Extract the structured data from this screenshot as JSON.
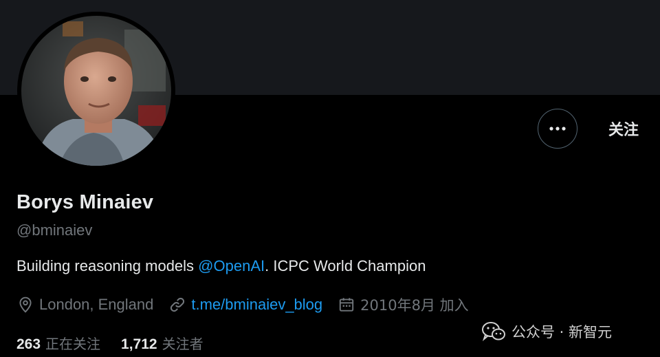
{
  "profile": {
    "display_name": "Borys Minaiev",
    "handle": "@bminaiev",
    "bio": {
      "prefix": "Building reasoning models ",
      "mention": "@OpenAI",
      "suffix": ". ICPC World Champion"
    },
    "location": "London, England",
    "link": "t.me/bminaiev_blog",
    "joined": "2010年8月 加入"
  },
  "actions": {
    "more_icon": "more-horizontal-icon",
    "follow_label": "关注"
  },
  "stats": {
    "following_count": "263",
    "following_label": "正在关注",
    "followers_count": "1,712",
    "followers_label": "关注者"
  },
  "watermark": {
    "icon": "wechat-icon",
    "text": "公众号 · 新智元"
  },
  "colors": {
    "background": "#000000",
    "banner": "#16181c",
    "text_primary": "#e7e9ea",
    "text_secondary": "#71767b",
    "link": "#1d9bf0"
  }
}
